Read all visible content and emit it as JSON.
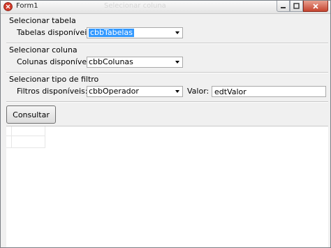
{
  "window": {
    "title": "Form1",
    "ghost_title": "Selecionar coluna"
  },
  "sections": {
    "tabela": {
      "title": "Selecionar tabela",
      "label": "Tabelas disponíveis:",
      "combo_value": "cbbTabelas"
    },
    "coluna": {
      "title": "Selecionar coluna",
      "label": "Colunas disponíveis:",
      "combo_value": "cbbColunas"
    },
    "filtro": {
      "title": "Selecionar tipo de filtro",
      "label": "Filtros disponíveis:",
      "combo_value": "cbbOperador",
      "valor_label": "Valor:",
      "valor_value": "edtValor"
    }
  },
  "buttons": {
    "consultar": "Consultar"
  },
  "icons": {
    "app": "delphi-app-icon",
    "minimize": "minimize-icon",
    "maximize": "maximize-icon",
    "close": "close-icon",
    "dropdown": "chevron-down-icon"
  },
  "colors": {
    "selection": "#3399ff",
    "close_button": "#c6452f"
  }
}
